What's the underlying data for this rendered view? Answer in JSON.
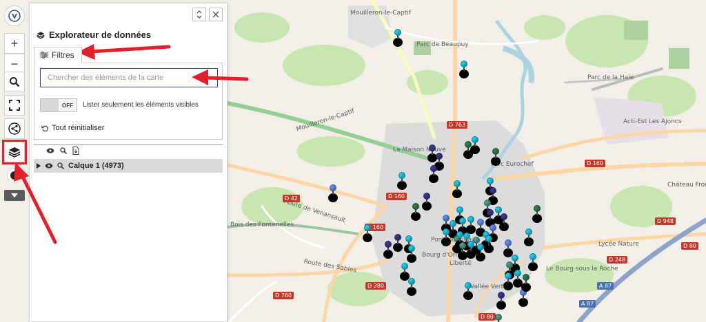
{
  "toolbar": {
    "buttons": [
      {
        "name": "logo-button",
        "icon": "logo-icon"
      },
      {
        "name": "zoom-in-button",
        "icon": "plus-icon",
        "label": "+"
      },
      {
        "name": "zoom-out-button",
        "icon": "minus-icon",
        "label": "−"
      },
      {
        "name": "search-button",
        "icon": "search-icon"
      },
      {
        "name": "fullscreen-button",
        "icon": "fullscreen-icon"
      },
      {
        "name": "share-button",
        "icon": "share-icon"
      },
      {
        "name": "layers-button",
        "icon": "layers-icon",
        "highlighted": true
      },
      {
        "name": "locate-button",
        "icon": "locate-icon"
      },
      {
        "name": "more-button",
        "icon": "caret-down-icon"
      }
    ]
  },
  "panel": {
    "title": "Explorateur de données",
    "tab_filters": "Filtres",
    "search": {
      "placeholder": "Chercher des éléments de la carte",
      "value": ""
    },
    "visible_toggle": {
      "state": "OFF",
      "label": "Lister seulement les éléments visibles"
    },
    "reset_label": "Tout réinitialiser",
    "layer": {
      "name": "Calque 1 (4973)"
    }
  },
  "map": {
    "labels": [
      "Mouilleron-le-Captif",
      "Parc de Beaupuy",
      "Parc de la Haie",
      "Mouilleron-le-Captif",
      "La Maison Neuve",
      "Parc Eurochef",
      "Acti-Est Les Ajoncs",
      "Château Fromage",
      "Bois des Fontenelles",
      "Route de Venansault",
      "Liberté",
      "Vallée Verte",
      "Lycée Nature",
      "Le Bourg sous la Roche",
      "Route des Sables",
      "Pont Morineau",
      "Bourg d'Orne"
    ],
    "roads": [
      "D 763",
      "D 160",
      "D 42",
      "D 160",
      "D 160",
      "D 280",
      "D 760",
      "D 948",
      "D 248",
      "D 80",
      "D 80",
      "A 87",
      "A 87"
    ],
    "pin_colors": [
      "#1ec8e6",
      "#5b8def",
      "#2e7d4f",
      "#3a3a8c",
      "#4f9a8a"
    ]
  },
  "annotations": {
    "color": "#e0202a"
  }
}
